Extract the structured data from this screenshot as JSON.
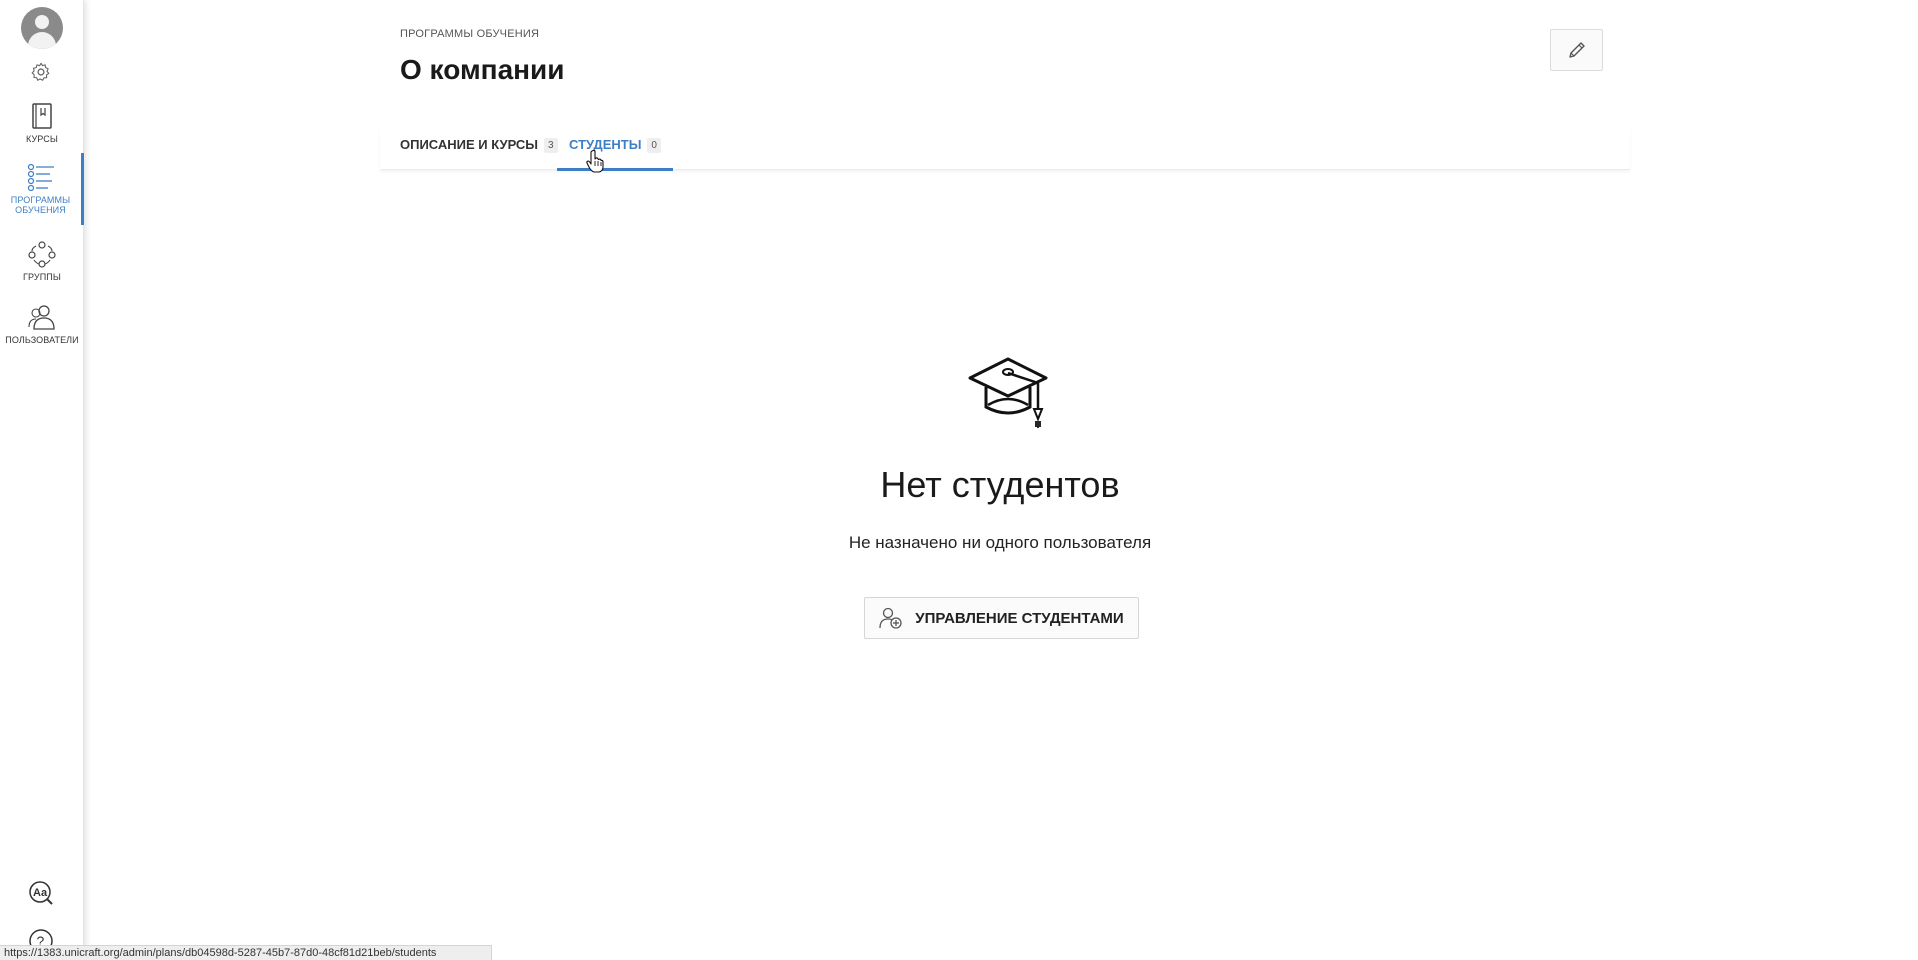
{
  "sidebar": {
    "items": [
      {
        "label": "КУРСЫ",
        "icon": "book-icon"
      },
      {
        "label": "ПРОГРАММЫ ОБУЧЕНИЯ",
        "icon": "list-icon",
        "active": true
      },
      {
        "label": "ГРУППЫ",
        "icon": "group-icon"
      },
      {
        "label": "ПОЛЬЗОВАТЕЛИ",
        "icon": "users-icon"
      }
    ],
    "accent_color": "#3d7fc4"
  },
  "header": {
    "breadcrumb": "ПРОГРАММЫ ОБУЧЕНИЯ",
    "title": "О компании"
  },
  "tabs": [
    {
      "label": "ОПИСАНИЕ И КУРСЫ",
      "count": "3"
    },
    {
      "label": "СТУДЕНТЫ",
      "count": "0",
      "active": true
    }
  ],
  "empty_state": {
    "icon": "graduation-cap-icon",
    "title": "Нет студентов",
    "subtitle": "Не назначено ни одного пользователя",
    "button_label": "УПРАВЛЕНИЕ СТУДЕНТАМИ"
  },
  "status_bar": {
    "url": "https://1383.unicraft.org/admin/plans/db04598d-5287-45b7-87d0-48cf81d21beb/students"
  }
}
